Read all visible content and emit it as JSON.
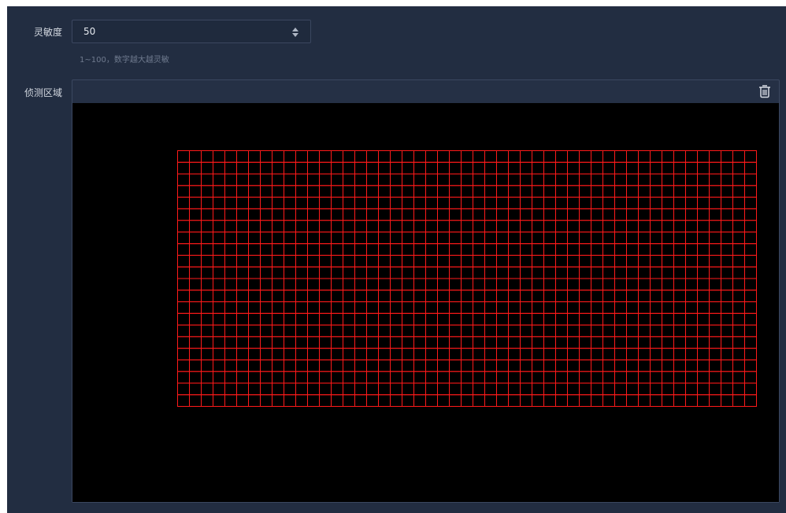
{
  "sensitivity": {
    "label": "灵敏度",
    "value": "50",
    "hint": "1~100，数字越大越灵敏"
  },
  "detection_area": {
    "label": "侦测区域",
    "delete_icon": "trash-icon",
    "grid": {
      "columns": 49,
      "rows": 22,
      "line_color": "#ff1a1a"
    }
  },
  "colors": {
    "panel_bg": "#222d41",
    "canvas_bg": "#000000",
    "grid_red": "#ff1a1a"
  }
}
